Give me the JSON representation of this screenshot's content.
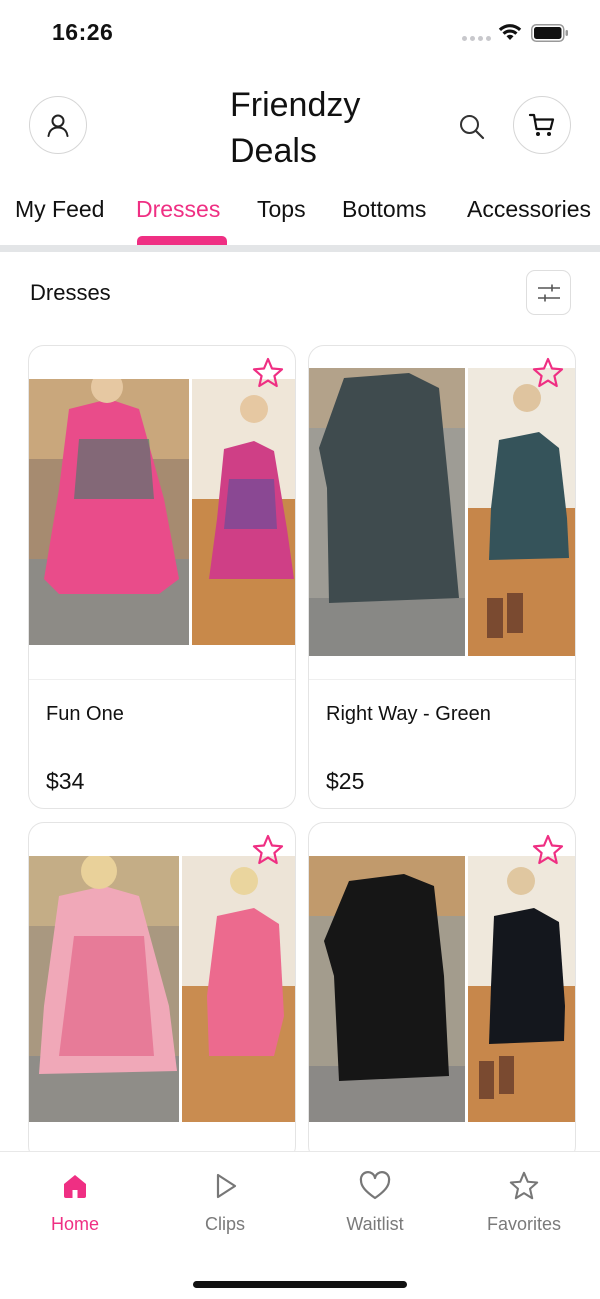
{
  "status_bar": {
    "time": "16:26"
  },
  "header": {
    "title": "Friendzy Deals",
    "profile_icon": "person-icon",
    "search_icon": "search-icon",
    "cart_icon": "cart-icon"
  },
  "tabs": [
    {
      "label": "My Feed",
      "active": false
    },
    {
      "label": "Dresses",
      "active": true
    },
    {
      "label": "Tops",
      "active": false
    },
    {
      "label": "Bottoms",
      "active": false
    },
    {
      "label": "Accessories",
      "active": false
    }
  ],
  "section": {
    "title": "Dresses",
    "filter_icon": "sliders-icon"
  },
  "products": [
    {
      "name": "Fun One",
      "price": "$34",
      "favorite_icon": "star-outline-icon"
    },
    {
      "name": "Right Way - Green",
      "price": "$25",
      "favorite_icon": "star-outline-icon"
    },
    {
      "name": "",
      "price": "",
      "favorite_icon": "star-outline-icon"
    },
    {
      "name": "",
      "price": "",
      "favorite_icon": "star-outline-icon"
    }
  ],
  "bottom_nav": [
    {
      "label": "Home",
      "icon": "home-icon",
      "active": true
    },
    {
      "label": "Clips",
      "icon": "play-icon",
      "active": false
    },
    {
      "label": "Waitlist",
      "icon": "heart-icon",
      "active": false
    },
    {
      "label": "Favorites",
      "icon": "star-icon",
      "active": false
    }
  ],
  "colors": {
    "accent": "#ef2f83",
    "text": "#111111",
    "muted": "#7a7a7a",
    "border": "#e4e4e4"
  }
}
